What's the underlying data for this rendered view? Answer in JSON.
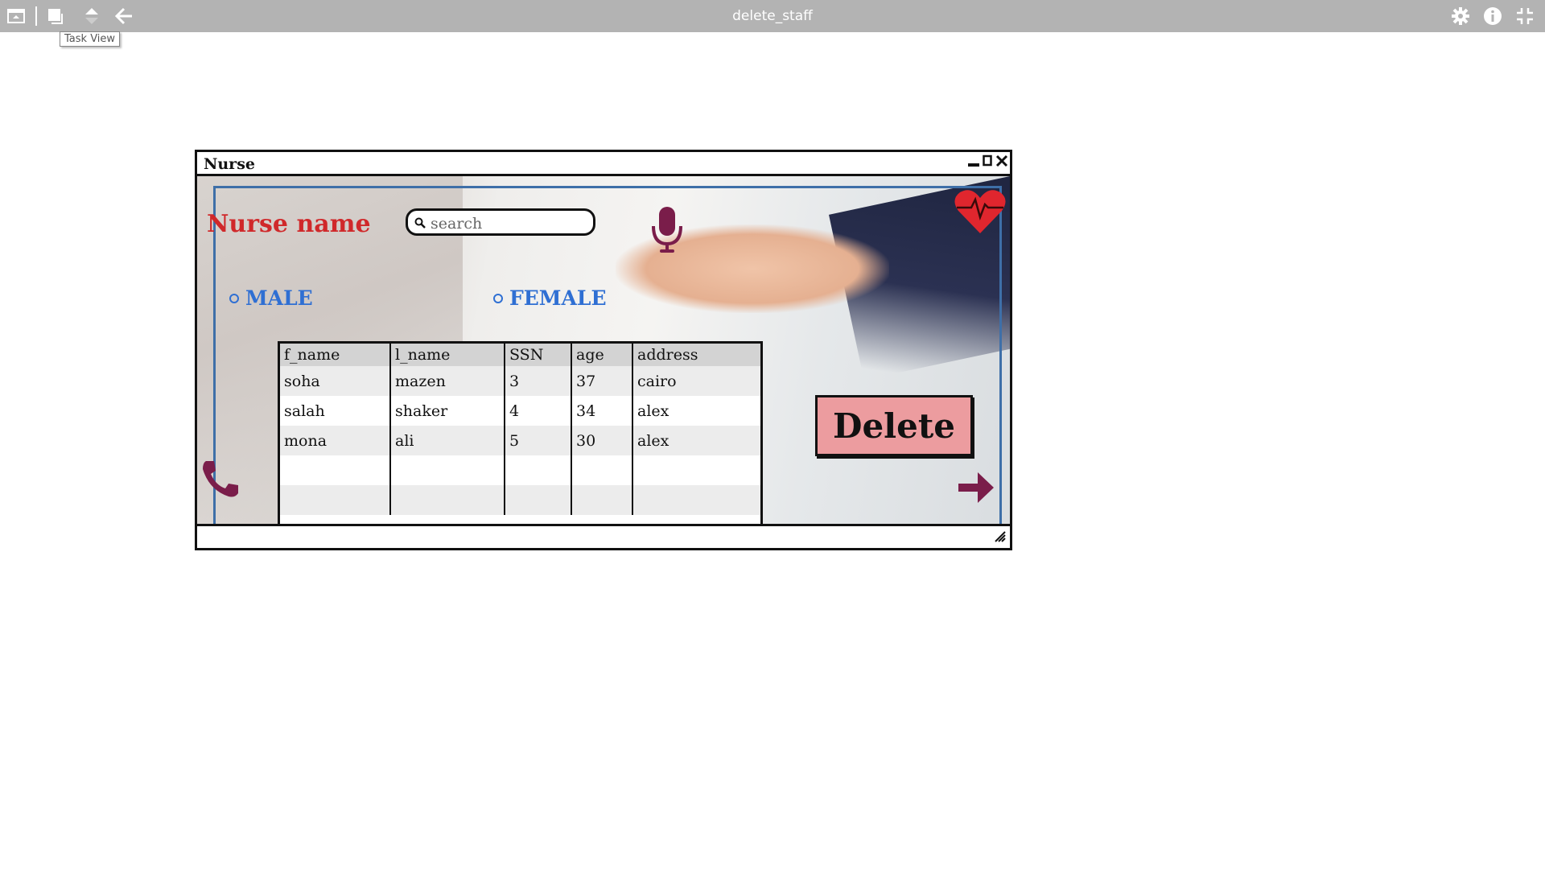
{
  "topbar": {
    "title": "delete_staff",
    "tooltip": "Task View",
    "icons": [
      "window-icon",
      "task-view-icon",
      "move-up-down-icon",
      "back-arrow-icon",
      "settings-gear-icon",
      "info-icon",
      "exit-fullscreen-icon"
    ]
  },
  "window": {
    "title": "Nurse",
    "controls": [
      "minimize-icon",
      "maximize-icon",
      "close-icon"
    ]
  },
  "form": {
    "nurse_label": "Nurse name",
    "search_placeholder": "search",
    "male_label": "MALE",
    "female_label": "FEMALE",
    "delete_label": "Delete"
  },
  "table": {
    "headers": [
      "f_name",
      "l_name",
      "SSN",
      "age",
      "address"
    ],
    "rows": [
      [
        "soha",
        "mazen",
        "3",
        "37",
        "cairo"
      ],
      [
        "salah",
        "shaker",
        "4",
        "34",
        "alex"
      ],
      [
        "mona",
        "ali",
        "5",
        "30",
        "alex"
      ],
      [
        "",
        "",
        "",
        "",
        ""
      ],
      [
        "",
        "",
        "",
        "",
        ""
      ]
    ]
  },
  "colors": {
    "topbar": "#b3b3b3",
    "nurse_label": "#d0282a",
    "radio": "#2f6fd3",
    "delete_button": "#ec9c9f",
    "icon_maroon": "#7a1d4a",
    "frame_blue": "#3e6fa8"
  }
}
